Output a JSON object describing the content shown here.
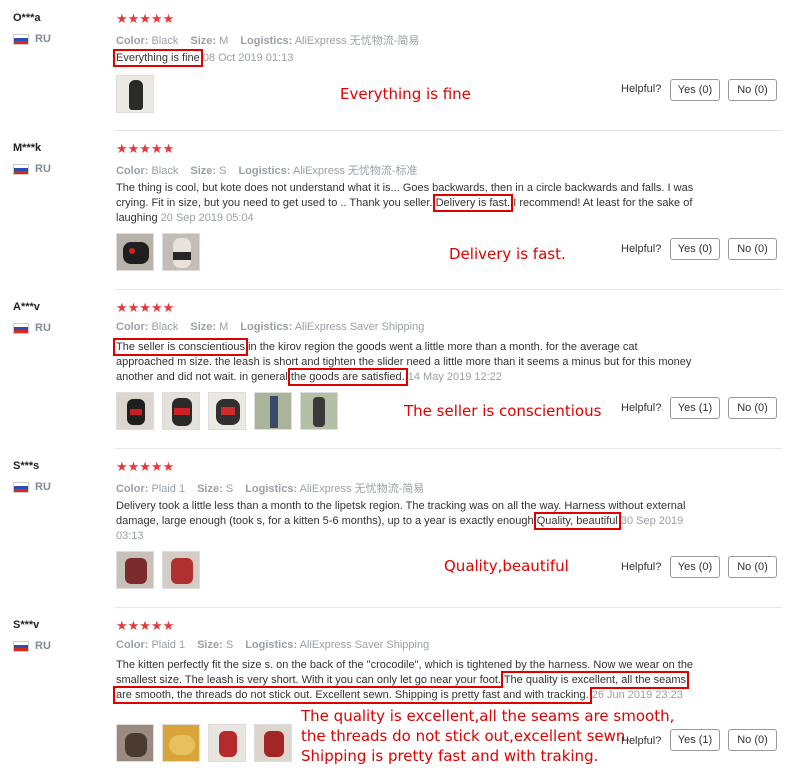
{
  "helpful_label": "Helpful?",
  "reviews": [
    {
      "user": "O***a",
      "country": "RU",
      "stars": "★★★★★",
      "color_label": "Color:",
      "color": "Black",
      "size_label": "Size:",
      "size": "M",
      "logistics_label": "Logistics:",
      "logistics": "AliExpress 无忧物流-简易",
      "text_parts": [
        "Everything is fine"
      ],
      "date": " 08 Oct 2019 01:13",
      "yes": "Yes (0)",
      "no": "No (0)",
      "annotation": "Everything is fine"
    },
    {
      "user": "M***k",
      "country": "RU",
      "stars": "★★★★★",
      "color_label": "Color:",
      "color": "Black",
      "size_label": "Size:",
      "size": "S",
      "logistics_label": "Logistics:",
      "logistics": "AliExpress 无忧物流-标准",
      "text_parts": [
        "The thing is cool, but kote does not understand what it is... Goes backwards, then in a circle backwards and falls. I was crying. Fit in size, but you need to get used to .. Thank you seller. ",
        "Delivery is fast.",
        " I recommend! At least for the sake of laughing"
      ],
      "date": " 20 Sep 2019 05:04",
      "yes": "Yes (0)",
      "no": "No (0)",
      "annotation": "Delivery is fast."
    },
    {
      "user": "A***v",
      "country": "RU",
      "stars": "★★★★★",
      "color_label": "Color:",
      "color": "Black",
      "size_label": "Size:",
      "size": "M",
      "logistics_label": "Logistics:",
      "logistics": "AliExpress Saver Shipping",
      "text_parts": [
        "The seller is conscientious",
        " in the kirov region the goods went a little more than a month. for the average cat approached m size. the leash is short and tighten the slider need a little more than it seems a minus but for this money another and did not wait. in general ",
        "the goods are satisfied."
      ],
      "date": " 14 May 2019 12:22",
      "yes": "Yes (1)",
      "no": "No (0)",
      "annotation": "The seller is conscientious"
    },
    {
      "user": "S***s",
      "country": "RU",
      "stars": "★★★★★",
      "color_label": "Color:",
      "color": "Plaid 1",
      "size_label": "Size:",
      "size": "S",
      "logistics_label": "Logistics:",
      "logistics": "AliExpress 无忧物流-简易",
      "text_parts": [
        "Delivery took a little less than a month to the lipetsk region. The tracking was on all the way. Harness without external damage, large enough (took s, for a kitten 5-6 months), up to a year is exactly enough ",
        "Quality, beautiful"
      ],
      "date": " 30 Sep 2019 03:13",
      "yes": "Yes (0)",
      "no": "No (0)",
      "annotation": "Quality,beautiful"
    },
    {
      "user": "S***v",
      "country": "RU",
      "stars": "★★★★★",
      "color_label": "Color:",
      "color": "Plaid 1",
      "size_label": "Size:",
      "size": "S",
      "logistics_label": "Logistics:",
      "logistics": "AliExpress Saver Shipping",
      "text_parts": [
        "The kitten perfectly fit the size s. on the back of the \"crocodile\", which is tightened by the harness. Now we wear on the smallest size. The leash is very short. With it you can only let go near your foot. ",
        "The quality is excellent, all the seams are smooth, the threads do not stick out. Excellent sewn. Shipping is pretty fast and with tracking."
      ],
      "date": " 26 Jun 2019 23:23",
      "yes": "Yes (1)",
      "no": "No (0)",
      "annotation_lines": [
        "The quality is excellent,all the seams are smooth,",
        "the threads do not stick out,excellent sewn.",
        "Shipping is pretty fast and with traking."
      ]
    }
  ]
}
